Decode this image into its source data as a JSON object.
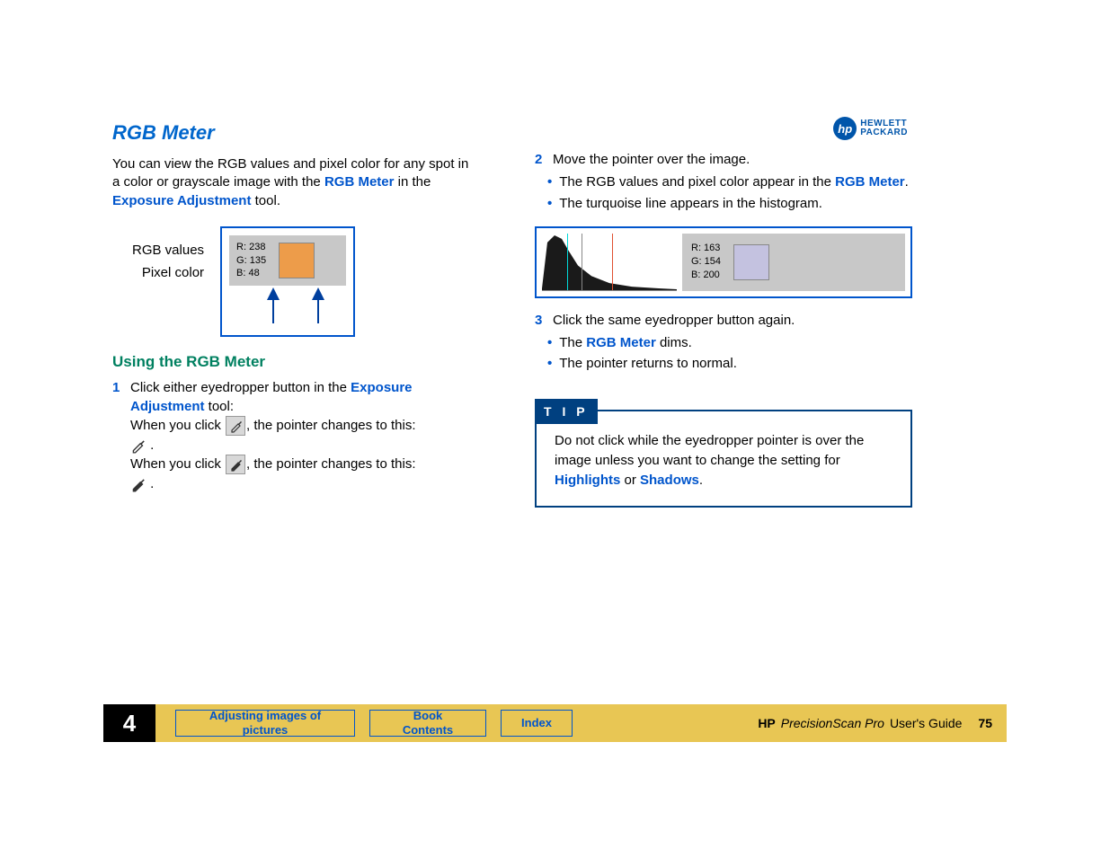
{
  "logo": {
    "brand1": "HEWLETT",
    "brand2": "PACKARD",
    "mark": "hp"
  },
  "left": {
    "title": "RGB Meter",
    "intro_a": "You can view the RGB values and pixel color for any spot in a color or grayscale image with the ",
    "link_rgb": "RGB Meter",
    "intro_b": " in the ",
    "link_exposure": "Exposure Adjustment",
    "intro_c": " tool.",
    "figlabel1": "RGB values",
    "figlabel2": "Pixel color",
    "rgb1": {
      "r": "R:  238",
      "g": "G:  135",
      "b": "B:   48"
    },
    "sub": "Using the RGB Meter",
    "step1_a": "Click either eyedropper button in the ",
    "step1_link": "Exposure Adjustment",
    "step1_b": " tool:",
    "line1a": "When you click ",
    "line1b": ", the pointer changes to this: ",
    "line1c": " .",
    "line2a": "When you click ",
    "line2b": ", the pointer changes to this: ",
    "line2c": " ."
  },
  "right": {
    "step2": "Move the pointer over the image.",
    "b2a_a": "The RGB values and pixel color appear in the ",
    "b2a_link": "RGB Meter",
    "b2a_b": ".",
    "b2b": "The turquoise line appears in the histogram.",
    "rgb2": {
      "r": "R:  163",
      "g": "G:  154",
      "b": "B:  200"
    },
    "step3": "Click the same eyedropper button again.",
    "b3a_a": "The ",
    "b3a_link": "RGB Meter",
    "b3a_b": " dims.",
    "b3b": "The pointer returns to normal.",
    "tip_label": "T I P",
    "tip_a": "Do not click while the eyedropper pointer is over the image unless you want to change the setting for ",
    "tip_l1": "Highlights",
    "tip_b": " or ",
    "tip_l2": "Shadows",
    "tip_c": "."
  },
  "footer": {
    "chapter": "4",
    "btn1": "Adjusting images of pictures",
    "btn2": "Book Contents",
    "btn3": "Index",
    "hp": "HP",
    "prod": "PrecisionScan Pro",
    "guide": " User's Guide",
    "page": "75"
  }
}
